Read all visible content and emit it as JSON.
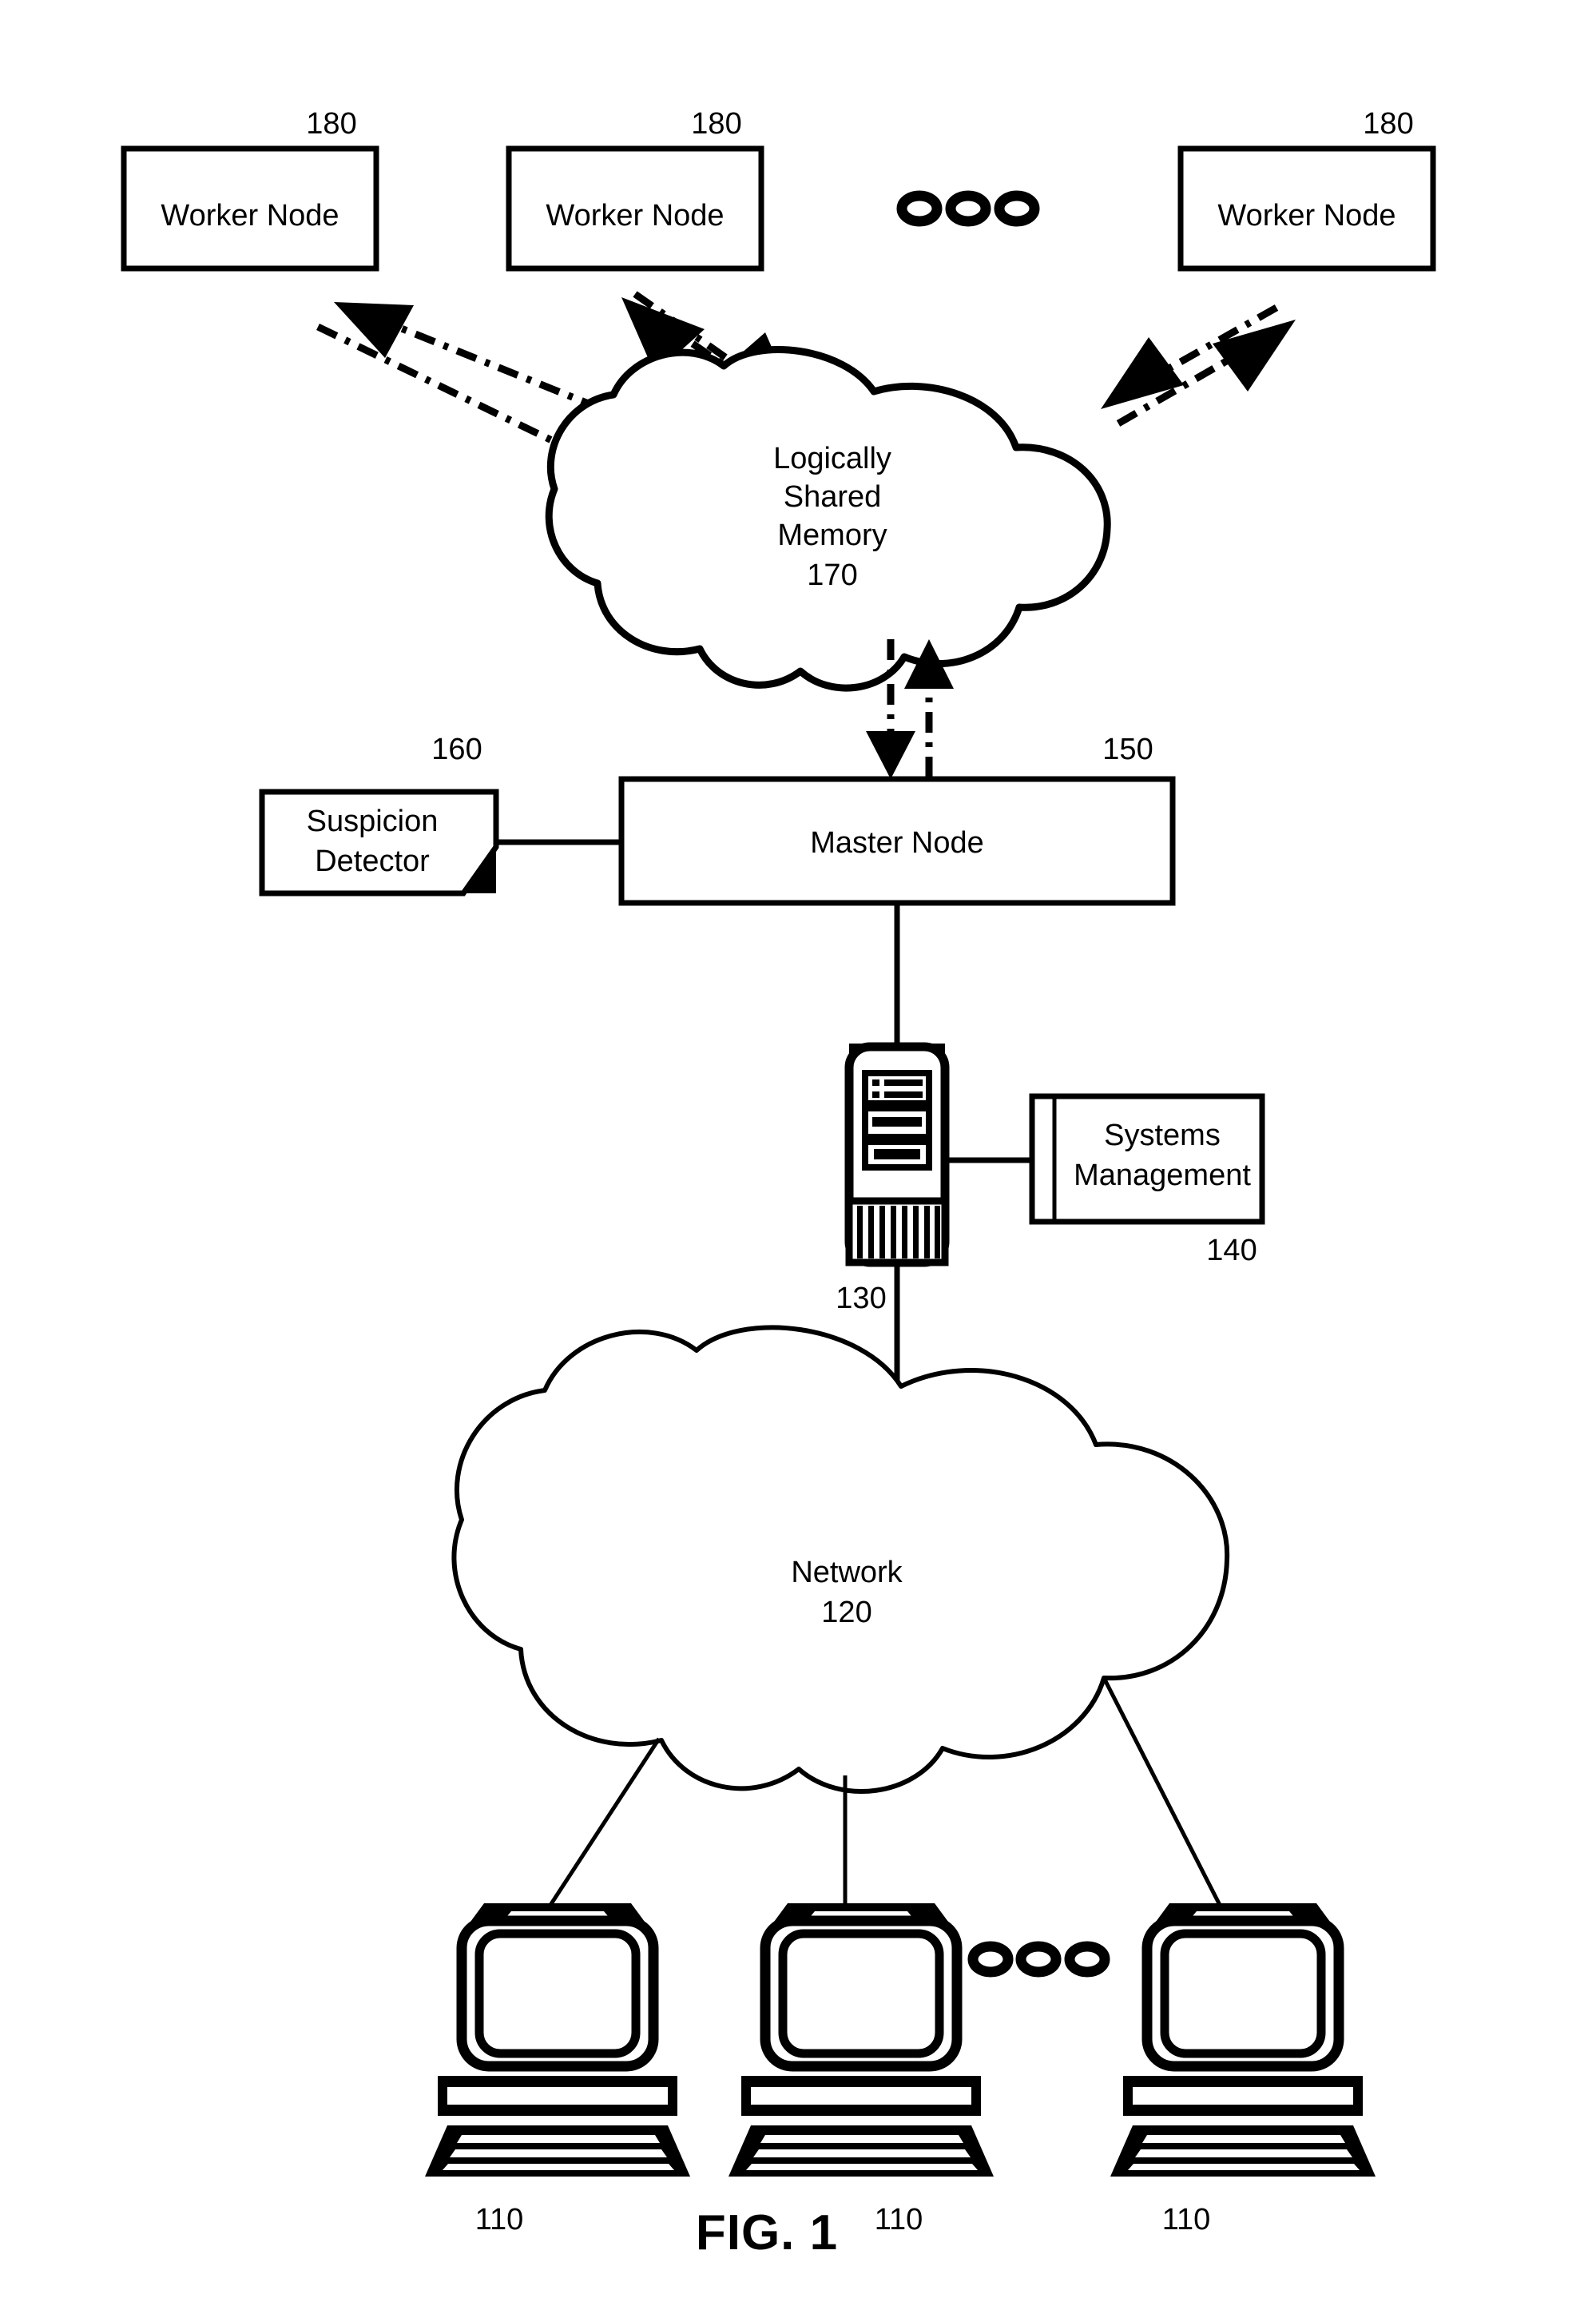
{
  "figure": {
    "caption": "FIG. 1"
  },
  "worker_nodes": [
    {
      "label": "Worker Node",
      "ref": "180"
    },
    {
      "label": "Worker Node",
      "ref": "180"
    },
    {
      "label": "Worker Node",
      "ref": "180"
    }
  ],
  "shared_memory": {
    "line1": "Logically",
    "line2": "Shared",
    "line3": "Memory",
    "ref": "170"
  },
  "suspicion_detector": {
    "line1": "Suspicion",
    "line2": "Detector",
    "ref": "160"
  },
  "master_node": {
    "label": "Master Node",
    "ref": "150"
  },
  "server": {
    "ref": "130",
    "icon": "server-rack-icon"
  },
  "systems_management": {
    "line1": "Systems",
    "line2": "Management",
    "ref": "140"
  },
  "network": {
    "label": "Network",
    "ref": "120"
  },
  "clients": [
    {
      "ref": "110",
      "icon": "workstation-icon"
    },
    {
      "ref": "110",
      "icon": "workstation-icon"
    },
    {
      "ref": "110",
      "icon": "workstation-icon"
    }
  ],
  "ellipsis": {
    "top": "ooo",
    "bottom": "ooo"
  },
  "colors": {
    "ink": "#000000",
    "paper": "#ffffff"
  }
}
